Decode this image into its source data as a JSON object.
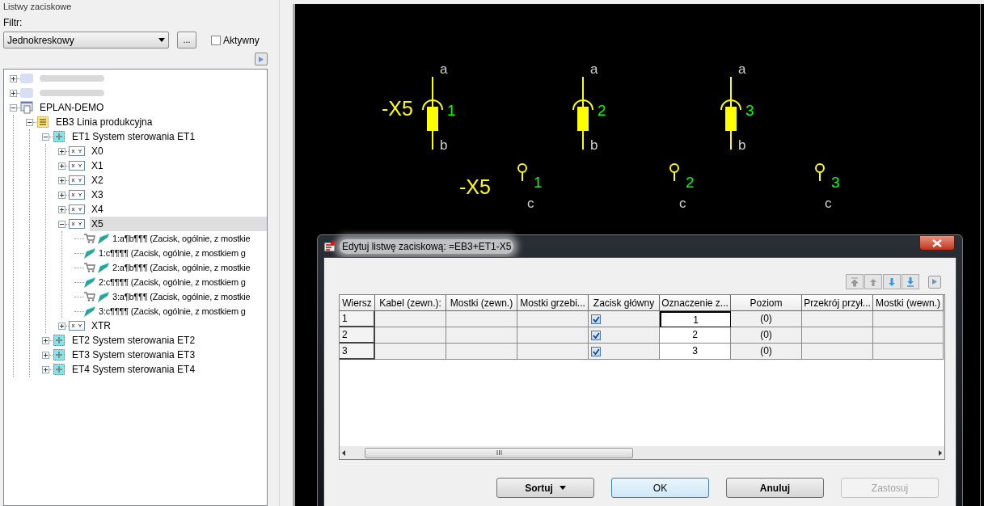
{
  "panel": {
    "title": "Listwy zaciskowe",
    "filter_label": "Filtr:",
    "filter_value": "Jednokreskowy",
    "browse_button": "...",
    "active_checkbox": {
      "label": "Aktywny",
      "checked": false
    }
  },
  "tree": [
    {
      "kind": "redacted",
      "expanded": false,
      "selected": false
    },
    {
      "kind": "redacted",
      "expanded": false,
      "selected": false
    },
    {
      "kind": "project",
      "label": "EPLAN-DEMO",
      "expanded": true,
      "selected": false,
      "children": [
        {
          "kind": "structure",
          "label": "EB3 Linia produkcyjna",
          "expanded": true,
          "selected": false,
          "children": [
            {
              "kind": "location",
              "label": "ET1 System sterowania ET1",
              "expanded": true,
              "selected": false,
              "children": [
                {
                  "kind": "strip",
                  "label": "X0",
                  "expanded": false,
                  "selected": false
                },
                {
                  "kind": "strip",
                  "label": "X1",
                  "expanded": false,
                  "selected": false
                },
                {
                  "kind": "strip",
                  "label": "X2",
                  "expanded": false,
                  "selected": false
                },
                {
                  "kind": "strip",
                  "label": "X3",
                  "expanded": false,
                  "selected": false
                },
                {
                  "kind": "strip",
                  "label": "X4",
                  "expanded": false,
                  "selected": false
                },
                {
                  "kind": "strip",
                  "label": "X5",
                  "expanded": true,
                  "selected": true,
                  "children": [
                    {
                      "kind": "terminal",
                      "label": "1:a¶b¶¶¶ (Zacisk, ogólnie, z mostkie",
                      "cart": true,
                      "selected": false
                    },
                    {
                      "kind": "terminal",
                      "label": "1:c¶¶¶¶ (Zacisk, ogólnie, z mostkiem g",
                      "cart": false,
                      "selected": false
                    },
                    {
                      "kind": "terminal",
                      "label": "2:a¶b¶¶¶ (Zacisk, ogólnie, z mostkie",
                      "cart": true,
                      "selected": false
                    },
                    {
                      "kind": "terminal",
                      "label": "2:c¶¶¶¶ (Zacisk, ogólnie, z mostkiem g",
                      "cart": false,
                      "selected": false
                    },
                    {
                      "kind": "terminal",
                      "label": "3:a¶b¶¶¶ (Zacisk, ogólnie, z mostkie",
                      "cart": true,
                      "selected": false
                    },
                    {
                      "kind": "terminal",
                      "label": "3:c¶¶¶¶ (Zacisk, ogólnie, z mostkiem g",
                      "cart": false,
                      "selected": false
                    }
                  ]
                },
                {
                  "kind": "strip",
                  "label": "XTR",
                  "expanded": false,
                  "selected": false
                }
              ]
            },
            {
              "kind": "location",
              "label": "ET2 System sterowania ET2",
              "expanded": false,
              "selected": false
            },
            {
              "kind": "location",
              "label": "ET3 System sterowania ET3",
              "expanded": false,
              "selected": false
            },
            {
              "kind": "location",
              "label": "ET4 System sterowania ET4",
              "expanded": false,
              "selected": false
            }
          ]
        }
      ]
    }
  ],
  "schematic": {
    "top_row": {
      "designation": "-X5",
      "terminals": [
        {
          "number": "1",
          "top": "a",
          "bottom": "b"
        },
        {
          "number": "2",
          "top": "a",
          "bottom": "b"
        },
        {
          "number": "3",
          "top": "a",
          "bottom": "b"
        }
      ]
    },
    "bottom_row": {
      "designation": "-X5",
      "terminals": [
        {
          "number": "1",
          "bottom": "c"
        },
        {
          "number": "2",
          "bottom": "c"
        },
        {
          "number": "3",
          "bottom": "c"
        }
      ]
    }
  },
  "dialog": {
    "title": "Edytuj listwę zaciskową: =EB3+ET1-X5",
    "columns": [
      "Wiersz",
      "Kabel (zewn.):",
      "Mostki (zewn.)",
      "Mostki grzebi...",
      "Zacisk główny",
      "Oznaczenie z...",
      "Poziom",
      "Przekrój przył...",
      "Mostki (wewn.)"
    ],
    "rows": [
      {
        "row": "1",
        "main_terminal": true,
        "designation": "1",
        "level": "(0)",
        "focused": true
      },
      {
        "row": "2",
        "main_terminal": true,
        "designation": "2",
        "level": "(0)",
        "focused": false
      },
      {
        "row": "3",
        "main_terminal": true,
        "designation": "3",
        "level": "(0)",
        "focused": false
      }
    ],
    "buttons": [
      {
        "label": "Sortuj",
        "kind": "menu",
        "disabled": false
      },
      {
        "label": "OK",
        "kind": "default",
        "disabled": false
      },
      {
        "label": "Anuluj",
        "kind": "normal",
        "disabled": false
      },
      {
        "label": "Zastosuj",
        "kind": "normal",
        "disabled": true
      }
    ]
  }
}
